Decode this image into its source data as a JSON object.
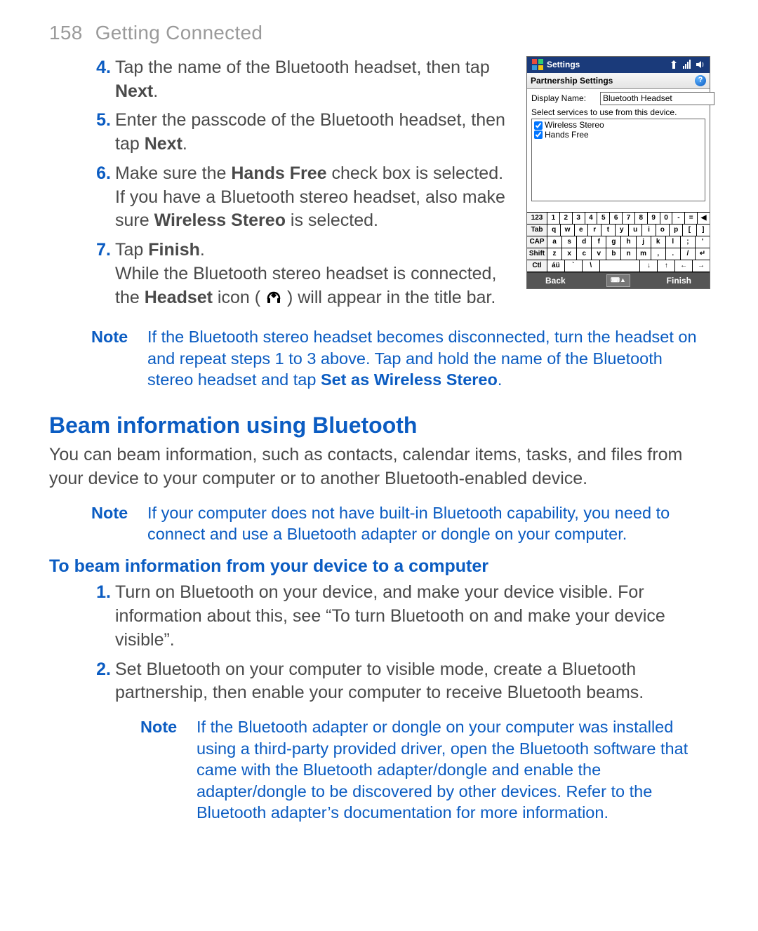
{
  "header": {
    "page_number": "158",
    "section": "Getting Connected"
  },
  "steps_a": [
    {
      "n": "4.",
      "parts": [
        "Tap the name of the Bluetooth headset, then tap ",
        "Next",
        "."
      ]
    },
    {
      "n": "5.",
      "parts": [
        "Enter the passcode of the Bluetooth headset, then tap ",
        "Next",
        "."
      ]
    },
    {
      "n": "6.",
      "parts": [
        "Make sure the ",
        "Hands Free",
        " check box is selected. If you have a Bluetooth stereo headset, also make sure ",
        "Wireless Stereo",
        " is selected."
      ]
    },
    {
      "n": "7.",
      "parts": [
        "Tap ",
        "Finish",
        "."
      ],
      "extra": [
        "While the Bluetooth stereo headset is connected, the ",
        "Headset",
        " icon ( ",
        "HEADSET_ICON",
        " ) will appear in the title bar."
      ]
    }
  ],
  "note1": {
    "label": "Note",
    "text_parts": [
      "If the Bluetooth stereo headset becomes disconnected, turn the headset on and repeat steps 1 to 3 above. Tap and hold the name of the Bluetooth stereo headset and tap ",
      "Set as Wireless Stereo",
      "."
    ]
  },
  "h2": "Beam information using Bluetooth",
  "para1": "You can beam information, such as contacts, calendar items, tasks, and files from your device to your computer or to another Bluetooth-enabled device.",
  "note2": {
    "label": "Note",
    "text": "If your computer does not have built-in Bluetooth capability, you need to connect and use a Bluetooth adapter or dongle on your computer."
  },
  "h3": "To beam information from your device to a computer",
  "steps_b": [
    {
      "n": "1.",
      "text": "Turn on Bluetooth on your device, and make your device visible. For information about this, see “To turn Bluetooth on and make your device visible”."
    },
    {
      "n": "2.",
      "text": "Set Bluetooth on your computer to visible mode, create a Bluetooth partnership, then enable your computer to receive Bluetooth beams."
    }
  ],
  "note3": {
    "label": "Note",
    "text": "If the Bluetooth adapter or dongle on your computer was installed using a third-party provided driver, open the Bluetooth software that came with the Bluetooth adapter/dongle and enable the adapter/dongle to be discovered by other devices. Refer to the Bluetooth adapter’s documentation for more information."
  },
  "device": {
    "titlebar": "Settings",
    "subtitle": "Partnership Settings",
    "display_name_label": "Display Name:",
    "display_name_value": "Bluetooth Headset",
    "hint": "Select services to use from this device.",
    "services": [
      "Wireless Stereo",
      "Hands Free"
    ],
    "softkeys": {
      "left": "Back",
      "right": "Finish",
      "kb": "⌨▲"
    },
    "keyboard": [
      [
        "123",
        "1",
        "2",
        "3",
        "4",
        "5",
        "6",
        "7",
        "8",
        "9",
        "0",
        "-",
        "=",
        "◀"
      ],
      [
        "Tab",
        "q",
        "w",
        "e",
        "r",
        "t",
        "y",
        "u",
        "i",
        "o",
        "p",
        "[",
        "]"
      ],
      [
        "CAP",
        "a",
        "s",
        "d",
        "f",
        "g",
        "h",
        "j",
        "k",
        "l",
        ";",
        "'"
      ],
      [
        "Shift",
        "z",
        "x",
        "c",
        "v",
        "b",
        "n",
        "m",
        ",",
        ".",
        "/",
        "↵"
      ],
      [
        "Ctl",
        "áü",
        "`",
        "\\",
        " ",
        "↓",
        "↑",
        "←",
        "→"
      ]
    ]
  }
}
